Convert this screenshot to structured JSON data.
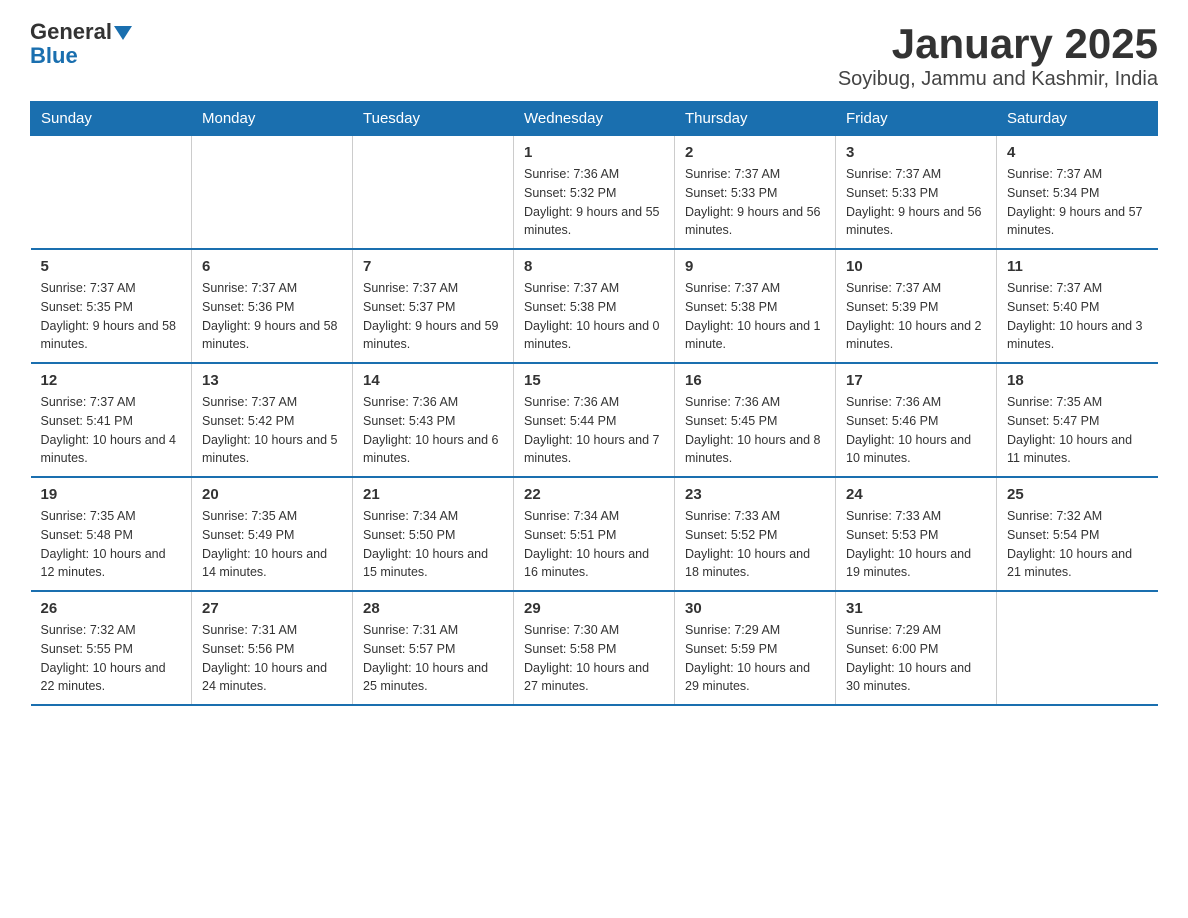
{
  "header": {
    "logo": {
      "general": "General",
      "blue": "Blue"
    },
    "title": "January 2025",
    "location": "Soyibug, Jammu and Kashmir, India"
  },
  "days_of_week": [
    "Sunday",
    "Monday",
    "Tuesday",
    "Wednesday",
    "Thursday",
    "Friday",
    "Saturday"
  ],
  "weeks": [
    [
      {
        "day": "",
        "info": ""
      },
      {
        "day": "",
        "info": ""
      },
      {
        "day": "",
        "info": ""
      },
      {
        "day": "1",
        "info": "Sunrise: 7:36 AM\nSunset: 5:32 PM\nDaylight: 9 hours and 55 minutes."
      },
      {
        "day": "2",
        "info": "Sunrise: 7:37 AM\nSunset: 5:33 PM\nDaylight: 9 hours and 56 minutes."
      },
      {
        "day": "3",
        "info": "Sunrise: 7:37 AM\nSunset: 5:33 PM\nDaylight: 9 hours and 56 minutes."
      },
      {
        "day": "4",
        "info": "Sunrise: 7:37 AM\nSunset: 5:34 PM\nDaylight: 9 hours and 57 minutes."
      }
    ],
    [
      {
        "day": "5",
        "info": "Sunrise: 7:37 AM\nSunset: 5:35 PM\nDaylight: 9 hours and 58 minutes."
      },
      {
        "day": "6",
        "info": "Sunrise: 7:37 AM\nSunset: 5:36 PM\nDaylight: 9 hours and 58 minutes."
      },
      {
        "day": "7",
        "info": "Sunrise: 7:37 AM\nSunset: 5:37 PM\nDaylight: 9 hours and 59 minutes."
      },
      {
        "day": "8",
        "info": "Sunrise: 7:37 AM\nSunset: 5:38 PM\nDaylight: 10 hours and 0 minutes."
      },
      {
        "day": "9",
        "info": "Sunrise: 7:37 AM\nSunset: 5:38 PM\nDaylight: 10 hours and 1 minute."
      },
      {
        "day": "10",
        "info": "Sunrise: 7:37 AM\nSunset: 5:39 PM\nDaylight: 10 hours and 2 minutes."
      },
      {
        "day": "11",
        "info": "Sunrise: 7:37 AM\nSunset: 5:40 PM\nDaylight: 10 hours and 3 minutes."
      }
    ],
    [
      {
        "day": "12",
        "info": "Sunrise: 7:37 AM\nSunset: 5:41 PM\nDaylight: 10 hours and 4 minutes."
      },
      {
        "day": "13",
        "info": "Sunrise: 7:37 AM\nSunset: 5:42 PM\nDaylight: 10 hours and 5 minutes."
      },
      {
        "day": "14",
        "info": "Sunrise: 7:36 AM\nSunset: 5:43 PM\nDaylight: 10 hours and 6 minutes."
      },
      {
        "day": "15",
        "info": "Sunrise: 7:36 AM\nSunset: 5:44 PM\nDaylight: 10 hours and 7 minutes."
      },
      {
        "day": "16",
        "info": "Sunrise: 7:36 AM\nSunset: 5:45 PM\nDaylight: 10 hours and 8 minutes."
      },
      {
        "day": "17",
        "info": "Sunrise: 7:36 AM\nSunset: 5:46 PM\nDaylight: 10 hours and 10 minutes."
      },
      {
        "day": "18",
        "info": "Sunrise: 7:35 AM\nSunset: 5:47 PM\nDaylight: 10 hours and 11 minutes."
      }
    ],
    [
      {
        "day": "19",
        "info": "Sunrise: 7:35 AM\nSunset: 5:48 PM\nDaylight: 10 hours and 12 minutes."
      },
      {
        "day": "20",
        "info": "Sunrise: 7:35 AM\nSunset: 5:49 PM\nDaylight: 10 hours and 14 minutes."
      },
      {
        "day": "21",
        "info": "Sunrise: 7:34 AM\nSunset: 5:50 PM\nDaylight: 10 hours and 15 minutes."
      },
      {
        "day": "22",
        "info": "Sunrise: 7:34 AM\nSunset: 5:51 PM\nDaylight: 10 hours and 16 minutes."
      },
      {
        "day": "23",
        "info": "Sunrise: 7:33 AM\nSunset: 5:52 PM\nDaylight: 10 hours and 18 minutes."
      },
      {
        "day": "24",
        "info": "Sunrise: 7:33 AM\nSunset: 5:53 PM\nDaylight: 10 hours and 19 minutes."
      },
      {
        "day": "25",
        "info": "Sunrise: 7:32 AM\nSunset: 5:54 PM\nDaylight: 10 hours and 21 minutes."
      }
    ],
    [
      {
        "day": "26",
        "info": "Sunrise: 7:32 AM\nSunset: 5:55 PM\nDaylight: 10 hours and 22 minutes."
      },
      {
        "day": "27",
        "info": "Sunrise: 7:31 AM\nSunset: 5:56 PM\nDaylight: 10 hours and 24 minutes."
      },
      {
        "day": "28",
        "info": "Sunrise: 7:31 AM\nSunset: 5:57 PM\nDaylight: 10 hours and 25 minutes."
      },
      {
        "day": "29",
        "info": "Sunrise: 7:30 AM\nSunset: 5:58 PM\nDaylight: 10 hours and 27 minutes."
      },
      {
        "day": "30",
        "info": "Sunrise: 7:29 AM\nSunset: 5:59 PM\nDaylight: 10 hours and 29 minutes."
      },
      {
        "day": "31",
        "info": "Sunrise: 7:29 AM\nSunset: 6:00 PM\nDaylight: 10 hours and 30 minutes."
      },
      {
        "day": "",
        "info": ""
      }
    ]
  ]
}
